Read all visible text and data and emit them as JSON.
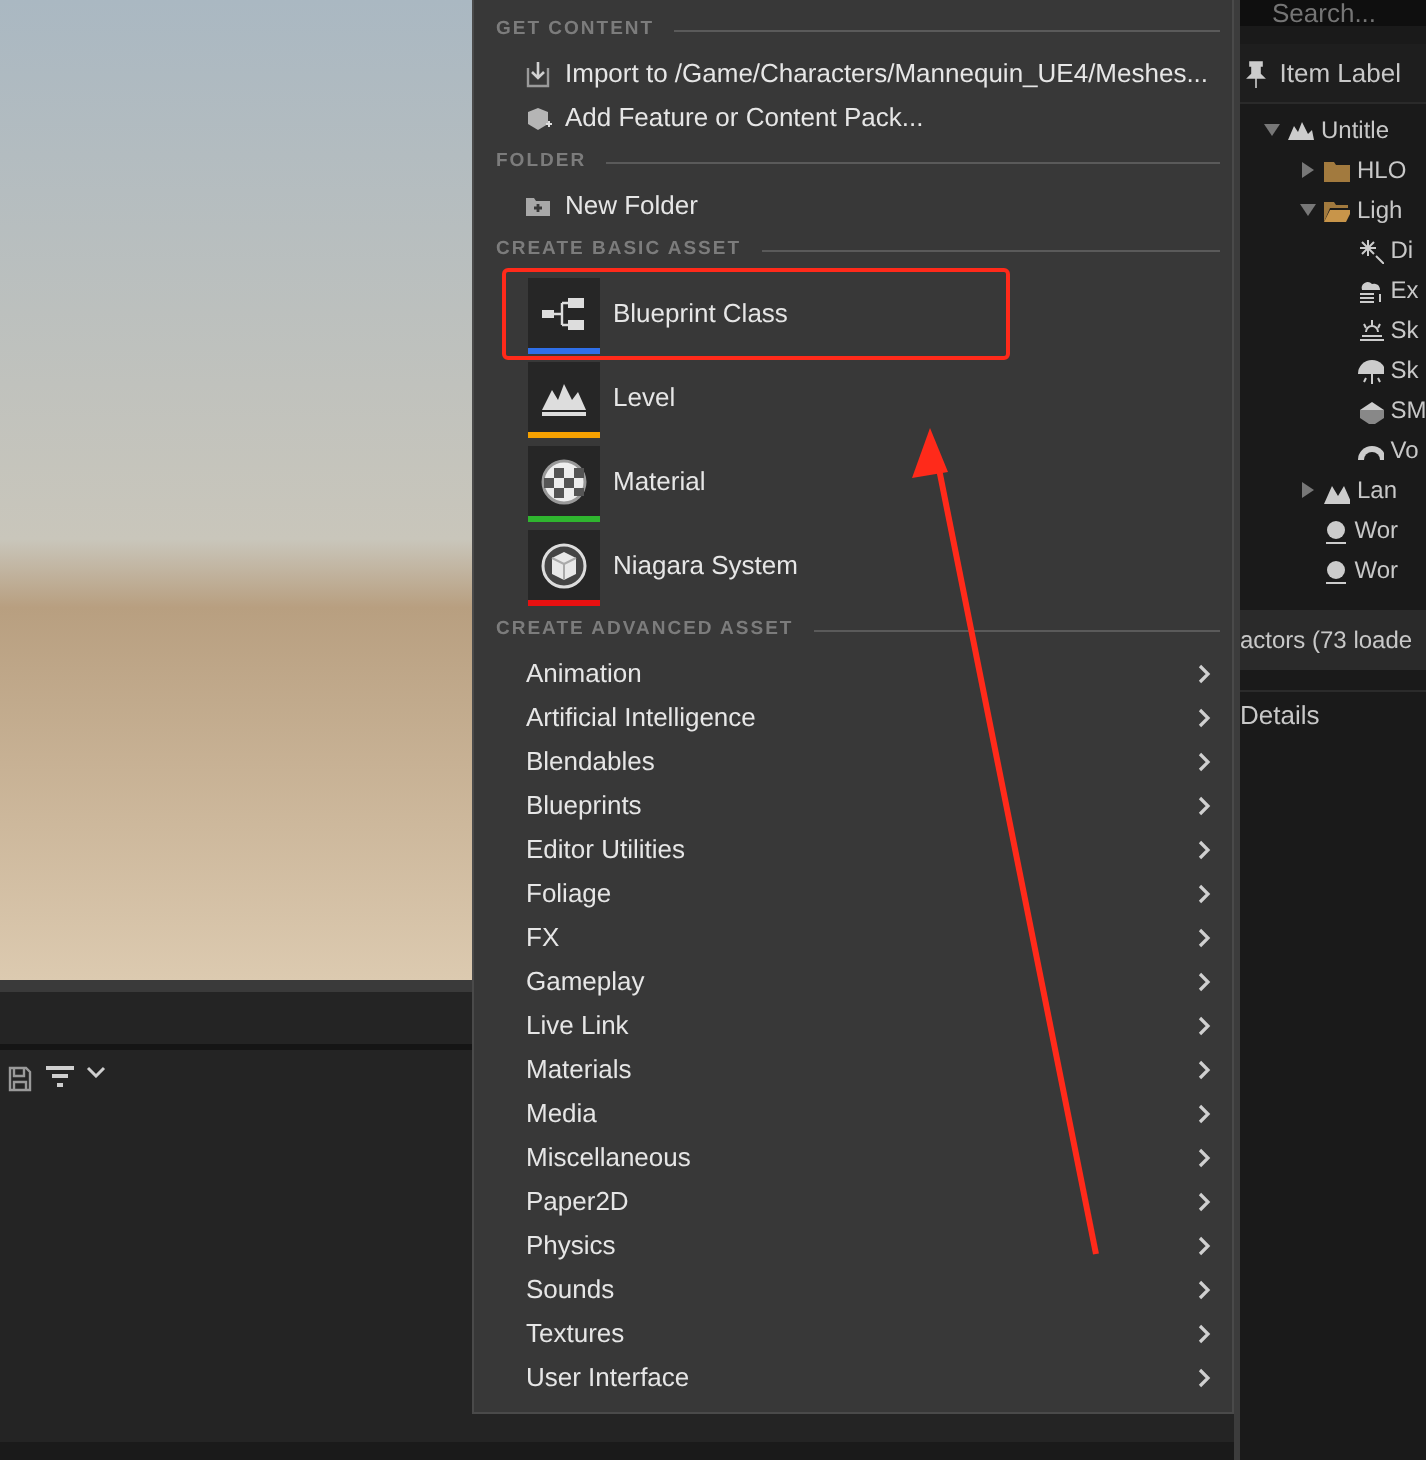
{
  "viewport": {
    "toolbar": [
      {
        "kind": "save"
      },
      {
        "kind": "filter"
      },
      {
        "kind": "caret"
      }
    ]
  },
  "menu": {
    "sections": [
      {
        "title": "GET CONTENT",
        "kind": "actions",
        "items": [
          {
            "label": "Import to /Game/Characters/Mannequin_UE4/Meshes...",
            "kind": "import"
          },
          {
            "label": "Add Feature or Content Pack...",
            "kind": "pack"
          }
        ]
      },
      {
        "title": "FOLDER",
        "kind": "actions",
        "items": [
          {
            "label": "New Folder",
            "kind": "folder"
          }
        ]
      },
      {
        "title": "CREATE BASIC ASSET",
        "kind": "assets",
        "items": [
          {
            "label": "Blueprint Class",
            "kind": "blueprint",
            "color": "#2f6fe8",
            "highlighted": true
          },
          {
            "label": "Level",
            "kind": "level",
            "color": "#f5a000",
            "highlighted": false
          },
          {
            "label": "Material",
            "kind": "material",
            "color": "#2fb52f",
            "highlighted": false
          },
          {
            "label": "Niagara System",
            "kind": "niagara",
            "color": "#e81010",
            "highlighted": false
          }
        ]
      },
      {
        "title": "CREATE ADVANCED ASSET",
        "kind": "submenus",
        "items": [
          {
            "label": "Animation"
          },
          {
            "label": "Artificial Intelligence"
          },
          {
            "label": "Blendables"
          },
          {
            "label": "Blueprints"
          },
          {
            "label": "Editor Utilities"
          },
          {
            "label": "Foliage"
          },
          {
            "label": "FX"
          },
          {
            "label": "Gameplay"
          },
          {
            "label": "Live Link"
          },
          {
            "label": "Materials"
          },
          {
            "label": "Media"
          },
          {
            "label": "Miscellaneous"
          },
          {
            "label": "Paper2D"
          },
          {
            "label": "Physics"
          },
          {
            "label": "Sounds"
          },
          {
            "label": "Textures"
          },
          {
            "label": "User Interface"
          }
        ]
      }
    ]
  },
  "outliner": {
    "search": {
      "placeholder": "Search..."
    },
    "column": "Item Label",
    "tree": [
      {
        "label": "Untitle",
        "kind": "level",
        "expanded": true,
        "children": [
          {
            "label": "HLO",
            "kind": "folder",
            "expanded": false
          },
          {
            "label": "Ligh",
            "kind": "folder-open",
            "expanded": true,
            "children": [
              {
                "label": "Di",
                "kind": "light"
              },
              {
                "label": "Ex",
                "kind": "fog"
              },
              {
                "label": "Sk",
                "kind": "sky"
              },
              {
                "label": "Sk",
                "kind": "skylight"
              },
              {
                "label": "SM",
                "kind": "mesh"
              },
              {
                "label": "Vo",
                "kind": "clouds"
              }
            ]
          },
          {
            "label": "Lan",
            "kind": "landscape",
            "expanded": false
          },
          {
            "label": "Wor",
            "kind": "world"
          },
          {
            "label": "Wor",
            "kind": "world"
          }
        ]
      }
    ],
    "status": "actors (73 loade",
    "details_tab": "Details"
  },
  "annotation": {
    "arrow": true
  }
}
